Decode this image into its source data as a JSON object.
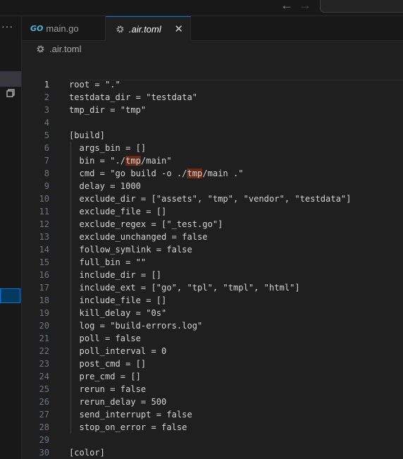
{
  "titlebar": {
    "back_icon": "arrow-left-icon",
    "forward_icon": "arrow-right-icon"
  },
  "sidebar": {
    "more_icon": "ellipsis-icon",
    "copy_icon": "restore-window-icon"
  },
  "tabs": [
    {
      "label": "main.go",
      "icon": "go-file-icon"
    },
    {
      "label": ".air.toml",
      "icon": "gear-icon",
      "active": true
    }
  ],
  "go_badge": "GO",
  "close_glyph": "✕",
  "breadcrumb": {
    "file": ".air.toml",
    "icon": "gear-icon"
  },
  "editor": {
    "active_line": 1,
    "highlight_term": "tmp",
    "lines": [
      {
        "n": "1",
        "text": "root = \".\""
      },
      {
        "n": "2",
        "text": "testdata_dir = \"testdata\""
      },
      {
        "n": "3",
        "text": "tmp_dir = \"tmp\""
      },
      {
        "n": "4",
        "text": ""
      },
      {
        "n": "5",
        "text": "[build]"
      },
      {
        "n": "6",
        "text": "  args_bin = []"
      },
      {
        "n": "7",
        "pre": "  bin = \"./",
        "hl": "tmp",
        "post": "/main\""
      },
      {
        "n": "8",
        "pre": "  cmd = \"go build -o ./",
        "hl": "tmp",
        "post": "/main .\""
      },
      {
        "n": "9",
        "text": "  delay = 1000"
      },
      {
        "n": "10",
        "text": "  exclude_dir = [\"assets\", \"tmp\", \"vendor\", \"testdata\"]"
      },
      {
        "n": "11",
        "text": "  exclude_file = []"
      },
      {
        "n": "12",
        "text": "  exclude_regex = [\"_test.go\"]"
      },
      {
        "n": "13",
        "text": "  exclude_unchanged = false"
      },
      {
        "n": "14",
        "text": "  follow_symlink = false"
      },
      {
        "n": "15",
        "text": "  full_bin = \"\""
      },
      {
        "n": "16",
        "text": "  include_dir = []"
      },
      {
        "n": "17",
        "text": "  include_ext = [\"go\", \"tpl\", \"tmpl\", \"html\"]"
      },
      {
        "n": "18",
        "text": "  include_file = []"
      },
      {
        "n": "19",
        "text": "  kill_delay = \"0s\""
      },
      {
        "n": "20",
        "text": "  log = \"build-errors.log\""
      },
      {
        "n": "21",
        "text": "  poll = false"
      },
      {
        "n": "22",
        "text": "  poll_interval = 0"
      },
      {
        "n": "23",
        "text": "  post_cmd = []"
      },
      {
        "n": "24",
        "text": "  pre_cmd = []"
      },
      {
        "n": "25",
        "text": "  rerun = false"
      },
      {
        "n": "26",
        "text": "  rerun_delay = 500"
      },
      {
        "n": "27",
        "text": "  send_interrupt = false"
      },
      {
        "n": "28",
        "text": "  stop_on_error = false"
      },
      {
        "n": "29",
        "text": ""
      },
      {
        "n": "30",
        "text": "[color]"
      }
    ]
  }
}
